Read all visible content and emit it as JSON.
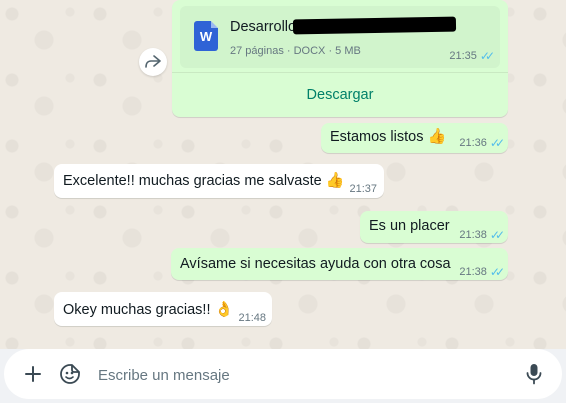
{
  "document_message": {
    "file_name_visible": "Desarrollo",
    "pages": "27 páginas",
    "type": "DOCX",
    "size": "5 MB",
    "time": "21:35",
    "download_label": "Descargar",
    "icon": "word-doc-icon",
    "icon_letter": "W"
  },
  "messages": [
    {
      "text": "Estamos listos",
      "emoji": "👍",
      "time": "21:36",
      "direction": "out"
    },
    {
      "text": "Excelente!! muchas gracias me salvaste",
      "emoji": "👍",
      "time": "21:37",
      "direction": "in"
    },
    {
      "text": "Es un placer",
      "emoji": "",
      "time": "21:38",
      "direction": "out"
    },
    {
      "text": "Avísame si necesitas ayuda con otra cosa",
      "emoji": "",
      "time": "21:38",
      "direction": "out"
    },
    {
      "text": "Okey muchas gracias!!",
      "emoji": "👌",
      "time": "21:48",
      "direction": "in"
    }
  ],
  "composer": {
    "placeholder": "Escribe un mensaje",
    "attach_icon": "plus-icon",
    "sticker_icon": "sticker-icon",
    "mic_icon": "microphone-icon"
  },
  "forward_icon": "forward-icon",
  "colors": {
    "outgoing_bubble": "#d9fdd3",
    "incoming_bubble": "#ffffff",
    "read_ticks": "#53bdeb",
    "accent": "#008069",
    "wallpaper": "#efeae2"
  }
}
